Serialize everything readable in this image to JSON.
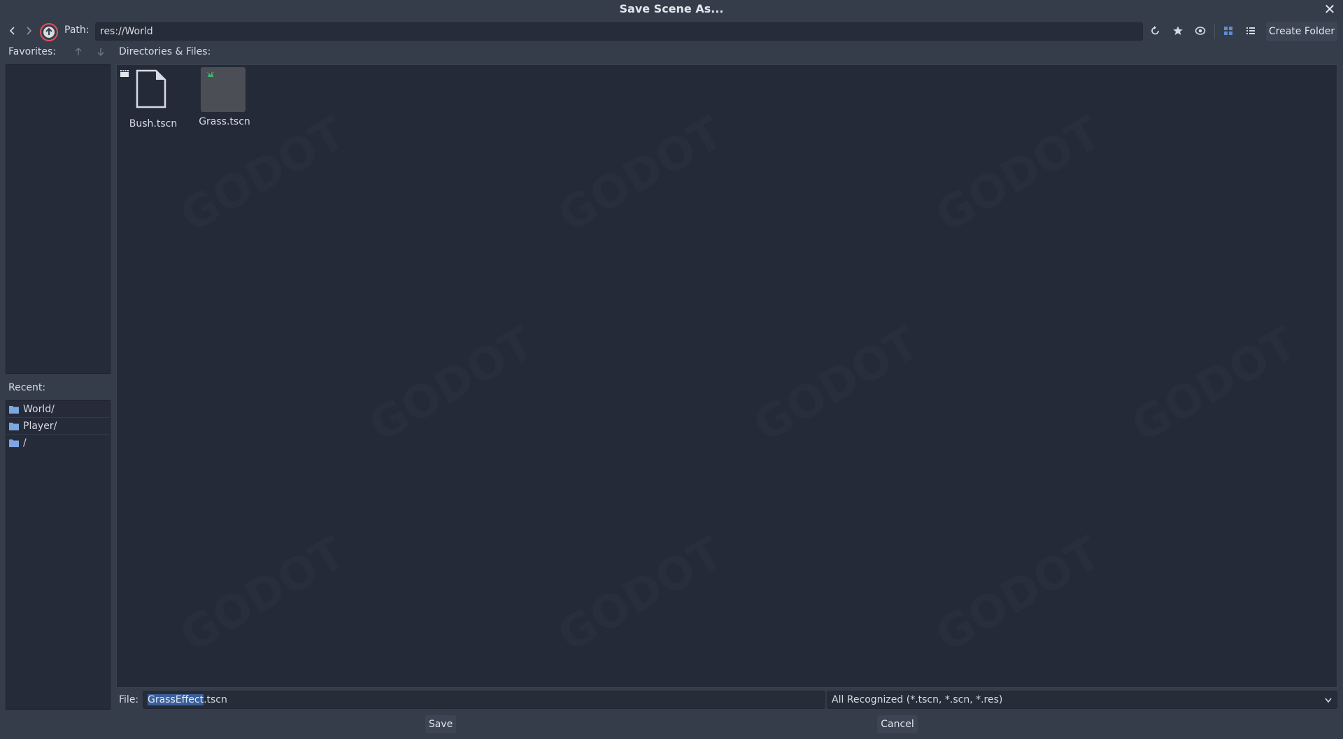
{
  "window": {
    "title": "Save Scene As..."
  },
  "toolbar": {
    "path_label": "Path:",
    "path_value": "res://World",
    "create_folder_label": "Create Folder",
    "icons": [
      "back-icon",
      "forward-icon",
      "go-up-icon",
      "refresh-icon",
      "favorite-star-icon",
      "show-hidden-icon",
      "grid-view-icon",
      "list-view-icon"
    ]
  },
  "favorites": {
    "label": "Favorites:"
  },
  "recent": {
    "label": "Recent:",
    "items": [
      {
        "label": "World/"
      },
      {
        "label": "Player/"
      },
      {
        "label": "/"
      }
    ]
  },
  "files": {
    "label": "Directories & Files:",
    "items": [
      {
        "name": "Bush.tscn",
        "icon": "file-icon"
      },
      {
        "name": "Grass.tscn",
        "icon": "scene-thumbnail"
      }
    ]
  },
  "footer": {
    "file_label": "File:",
    "file_name_selected": "GrassEffect",
    "file_name_rest": ".tscn",
    "filter_value": "All Recognized (*.tscn, *.scn, *.res)",
    "save_label": "Save",
    "cancel_label": "Cancel"
  },
  "colors": {
    "accent": "#5b8ed8",
    "background": "#363d4a",
    "panel": "#242a38",
    "highlight_ring": "#e0505a"
  }
}
